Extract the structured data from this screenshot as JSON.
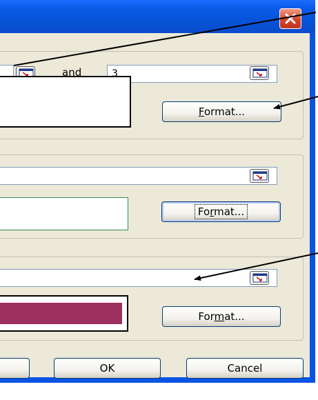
{
  "window": {
    "close_icon": "close-icon",
    "colors": {
      "titlebar": "#0753d8",
      "face": "#ece9d8",
      "close": "#d7452a"
    }
  },
  "condition1": {
    "connector_label": "and",
    "value2": "3",
    "format_button": {
      "prefix": "",
      "mnemonic": "F",
      "suffix": "ormat..."
    },
    "picker_icon": "range-picker-icon"
  },
  "condition2": {
    "value": "",
    "format_button": {
      "prefix": "Fo",
      "mnemonic": "r",
      "suffix": "mat..."
    },
    "preview_border_color": "#2e8b57"
  },
  "condition3": {
    "value": "",
    "format_button": {
      "prefix": "For",
      "mnemonic": "m",
      "suffix": "at..."
    },
    "preview_fill_color": "#9c3060"
  },
  "footer": {
    "ok_label": "OK",
    "cancel_label": "Cancel",
    "truncated_button_label": ""
  }
}
